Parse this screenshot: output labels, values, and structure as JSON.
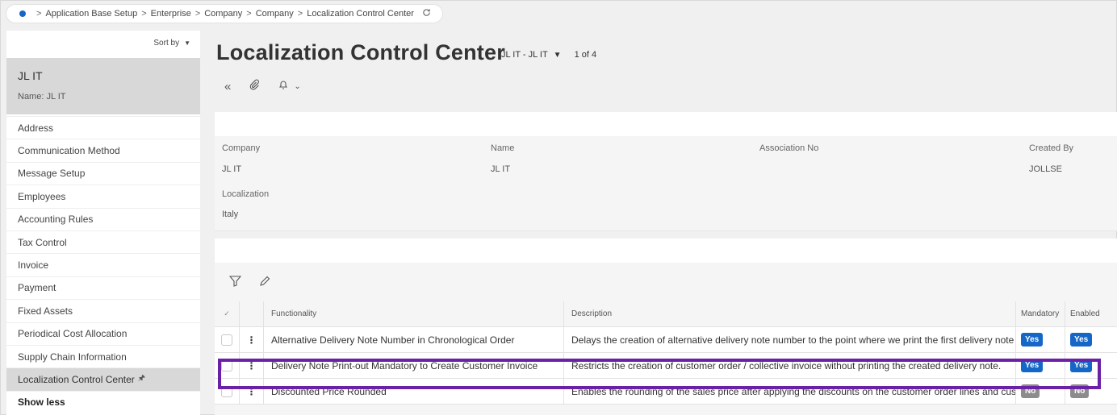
{
  "breadcrumb": {
    "items": [
      "Application Base Setup",
      "Enterprise",
      "Company",
      "Company",
      "Localization Control Center"
    ]
  },
  "sidebar": {
    "sort_label": "Sort by",
    "record_title": "JL IT",
    "record_subtitle": "Name:  JL IT",
    "items": [
      {
        "label": "Address"
      },
      {
        "label": "Communication Method"
      },
      {
        "label": "Message Setup"
      },
      {
        "label": "Employees"
      },
      {
        "label": "Accounting Rules"
      },
      {
        "label": "Tax Control"
      },
      {
        "label": "Invoice"
      },
      {
        "label": "Payment"
      },
      {
        "label": "Fixed Assets"
      },
      {
        "label": "Periodical Cost Allocation"
      },
      {
        "label": "Supply Chain Information"
      },
      {
        "label": "Localization Control Center"
      },
      {
        "label": "Show less"
      }
    ]
  },
  "page": {
    "title": "Localization Control Center",
    "context": "JL IT - JL IT",
    "record_count": "1 of 4"
  },
  "header_fields": {
    "company_label": "Company",
    "company_value": "JL IT",
    "name_label": "Name",
    "name_value": "JL IT",
    "assoc_label": "Association No",
    "assoc_value": "",
    "created_label": "Created By",
    "created_value": "JOLLSE",
    "localization_label": "Localization",
    "localization_value": "Italy"
  },
  "table": {
    "columns": {
      "functionality": "Functionality",
      "description": "Description",
      "mandatory": "Mandatory",
      "enabled": "Enabled"
    },
    "rows": [
      {
        "functionality": "Alternative Delivery Note Number in Chronological Order",
        "description": "Delays the creation of alternative delivery note number to the point where we print the first delivery note",
        "mandatory": "Yes",
        "enabled": "Yes"
      },
      {
        "functionality": "Delivery Note Print-out Mandatory to Create Customer Invoice",
        "description": "Restricts the creation of customer order / collective invoice without printing the created delivery note.",
        "mandatory": "Yes",
        "enabled": "Yes"
      },
      {
        "functionality": "Discounted Price Rounded",
        "description": "Enables the rounding of the sales price after applying the discounts on the customer order lines and customer",
        "mandatory": "No",
        "enabled": "No"
      }
    ]
  },
  "colors": {
    "accent": "#1467c7",
    "highlight": "#6a21a5",
    "badge_no": "#8c8c8c"
  }
}
